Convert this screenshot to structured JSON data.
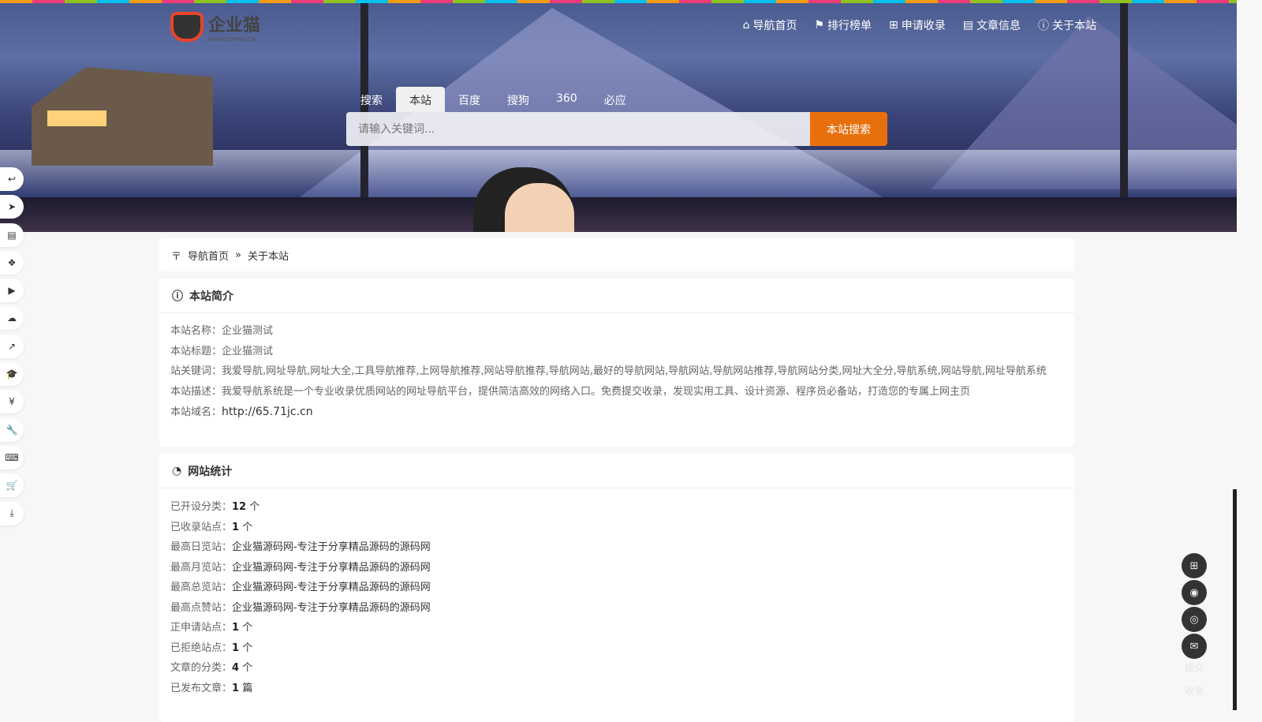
{
  "logo": {
    "name": "企业猫",
    "sub": "WWW.QYMAO.CN"
  },
  "nav": [
    {
      "icon": "home-icon",
      "label": "导航首页"
    },
    {
      "icon": "flag-icon",
      "label": "排行榜单"
    },
    {
      "icon": "plus-square-icon",
      "label": "申请收录"
    },
    {
      "icon": "book-icon",
      "label": "文章信息"
    },
    {
      "icon": "info-icon",
      "label": "关于本站"
    }
  ],
  "search": {
    "tabs": [
      "搜索",
      "本站",
      "百度",
      "搜狗",
      "360",
      "必应"
    ],
    "active": "本站",
    "placeholder": "请输入关键词...",
    "button": "本站搜索"
  },
  "breadcrumb": {
    "home": "导航首页",
    "sep": "»",
    "current": "关于本站"
  },
  "intro": {
    "title": "本站简介",
    "rows": [
      {
        "label": "本站名称：",
        "value": "企业猫测试"
      },
      {
        "label": "本站标题：",
        "value": "企业猫测试"
      },
      {
        "label": "站关键词：",
        "value": "我爱导航,网址导航,网址大全,工具导航推荐,上网导航推荐,网站导航推荐,导航网站,最好的导航网站,导航网站,导航网站推荐,导航网站分类,网址大全分,导航系统,网站导航,网址导航系统"
      },
      {
        "label": "本站描述：",
        "value": "我爱导航系统是一个专业收录优质网站的网址导航平台，提供简洁高效的网络入口。免费提交收录，发现实用工具、设计资源、程序员必备站，打造您的专属上网主页"
      },
      {
        "label": "本站域名：",
        "value": "http://65.71jc.cn"
      }
    ]
  },
  "stats": {
    "title": "网站统计",
    "rows": [
      {
        "label": "已开设分类：",
        "num": "12",
        "unit": " 个"
      },
      {
        "label": "已收录站点：",
        "num": "1",
        "unit": " 个"
      },
      {
        "label": "最高日览站：",
        "text": "企业猫源码网-专注于分享精品源码的源码网"
      },
      {
        "label": "最高月览站：",
        "text": "企业猫源码网-专注于分享精品源码的源码网"
      },
      {
        "label": "最高总览站：",
        "text": "企业猫源码网-专注于分享精品源码的源码网"
      },
      {
        "label": "最高点赞站：",
        "text": "企业猫源码网-专注于分享精品源码的源码网"
      },
      {
        "label": "正申请站点：",
        "num": "1",
        "unit": " 个"
      },
      {
        "label": "已拒绝站点：",
        "num": "1",
        "unit": " 个"
      },
      {
        "label": "文章的分类：",
        "num": "4",
        "unit": " 个"
      },
      {
        "label": "已发布文章：",
        "num": "1",
        "unit": " 篇"
      }
    ]
  },
  "sidebar": [
    "reply-icon",
    "paper-plane-icon",
    "file-icon",
    "cubes-icon",
    "youtube-icon",
    "cloud-icon",
    "chart-line-icon",
    "graduation-cap-icon",
    "yen-icon",
    "wrench-icon",
    "keyboard-icon",
    "cart-icon",
    "download-icon"
  ],
  "fabs": [
    "plus-square-icon",
    "qq-icon",
    "wechat-icon",
    "envelope-icon"
  ],
  "faint": [
    "提交",
    "收录"
  ]
}
